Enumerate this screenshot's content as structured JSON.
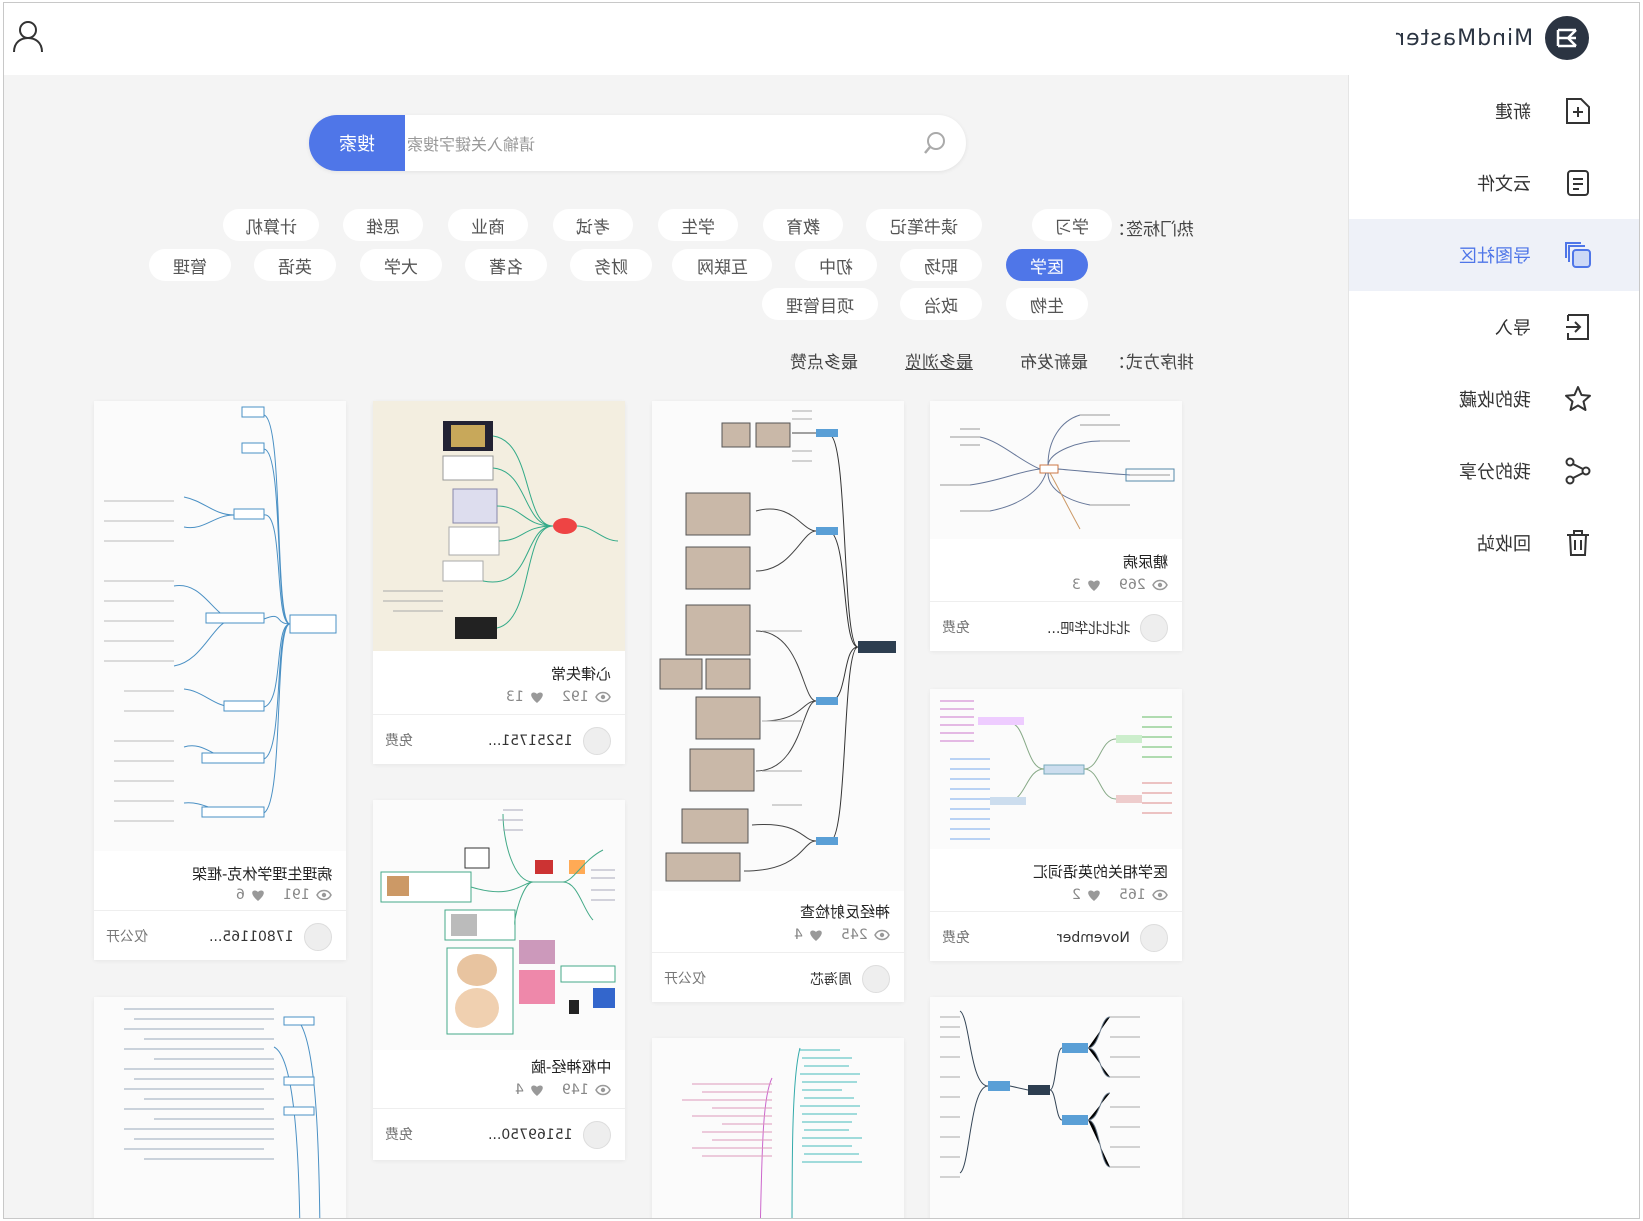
{
  "app": {
    "logo_text": "MindMaster"
  },
  "sidebar": {
    "items": [
      {
        "label": "新建",
        "icon": "new-file-icon"
      },
      {
        "label": "云文件",
        "icon": "cloud-file-icon"
      },
      {
        "label": "导图社区",
        "icon": "community-icon",
        "active": true
      },
      {
        "label": "导入",
        "icon": "import-icon"
      },
      {
        "label": "我的收藏",
        "icon": "star-icon"
      },
      {
        "label": "我的分享",
        "icon": "share-icon"
      },
      {
        "label": "回收站",
        "icon": "trash-icon"
      }
    ]
  },
  "search": {
    "button_label": "搜索",
    "placeholder": "请输入关键字搜索"
  },
  "tags": {
    "label": "热门标签：",
    "row1": [
      "学习",
      "读书笔记",
      "教育",
      "学生",
      "考试",
      "商业",
      "思维",
      "计算机"
    ],
    "row2": [
      "医学",
      "职场",
      "初中",
      "互联网",
      "财务",
      "名著",
      "大学",
      "英语",
      "管理"
    ],
    "row3": [
      "生物",
      "政治",
      "项目管理"
    ],
    "active": "医学"
  },
  "sort": {
    "label": "排序方式：",
    "options": [
      "最新发布",
      "最多浏览",
      "最多点赞"
    ]
  },
  "cards": [
    {
      "title": "病理生理学休克-框架",
      "views": "191",
      "likes": "6",
      "author": "17801165...",
      "price": "仅公开"
    },
    {
      "title": "心律失常",
      "views": "192",
      "likes": "13",
      "author": "15251751...",
      "price": "免费"
    },
    {
      "title": "中枢神经-脑",
      "views": "149",
      "likes": "4",
      "author": "15169750...",
      "price": "免费"
    },
    {
      "title": "神经反射检查",
      "views": "245",
      "likes": "4",
      "author": "周海芯",
      "price": "仅公开"
    },
    {
      "title": "糖尿病",
      "views": "269",
      "likes": "3",
      "author": "北北北华吧...",
      "price": "免费"
    },
    {
      "title": "医学相关的英语词汇",
      "views": "165",
      "likes": "2",
      "author": "November",
      "price": "免费"
    }
  ],
  "colors": {
    "accent": "#4f76e8",
    "page_bg": "#f4f4f4",
    "logo_dark": "#2b3442"
  }
}
